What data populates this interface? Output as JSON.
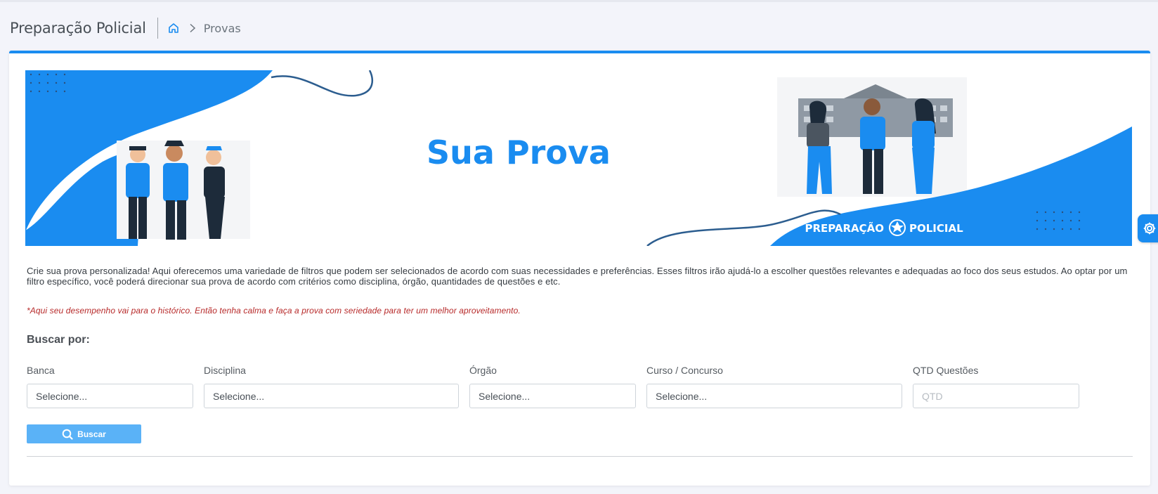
{
  "header": {
    "title": "Preparação Policial",
    "breadcrumb_current": "Provas",
    "home_icon": "home-icon",
    "separator_icon": "chevron-right-icon"
  },
  "banner": {
    "headline": "Sua Prova",
    "brand_left": "PREPARAÇÃO",
    "brand_right": "POLICIAL",
    "accent_color": "#1a8cf0"
  },
  "intro": {
    "text": "Crie sua prova personalizada! Aqui oferecemos uma variedade de filtros que podem ser selecionados de acordo com suas necessidades e preferências. Esses filtros irão ajudá-lo a escolher questões relevantes e adequadas ao foco dos seus estudos. Ao optar por um filtro específico, você poderá direcionar sua prova de acordo com critérios como disciplina, órgão, quantidades de questões e etc.",
    "warning": "*Aqui seu desempenho vai para o histórico. Então tenha calma e faça a prova com seriedade para ter um melhor aproveitamento."
  },
  "search": {
    "title": "Buscar por:",
    "filters": {
      "banca": {
        "label": "Banca",
        "value": "Selecione..."
      },
      "disciplina": {
        "label": "Disciplina",
        "value": "Selecione..."
      },
      "orgao": {
        "label": "Órgão",
        "value": "Selecione..."
      },
      "curso": {
        "label": "Curso / Concurso",
        "value": "Selecione..."
      },
      "qtd": {
        "label": "QTD Questões",
        "placeholder": "QTD",
        "value": ""
      }
    },
    "button_label": "Buscar",
    "button_icon": "search-icon"
  },
  "settings_icon": "gear-icon",
  "colors": {
    "primary": "#1a8cf0",
    "button": "#5ab2f7",
    "warning": "#b72a2a",
    "background": "#f3f4fa"
  }
}
